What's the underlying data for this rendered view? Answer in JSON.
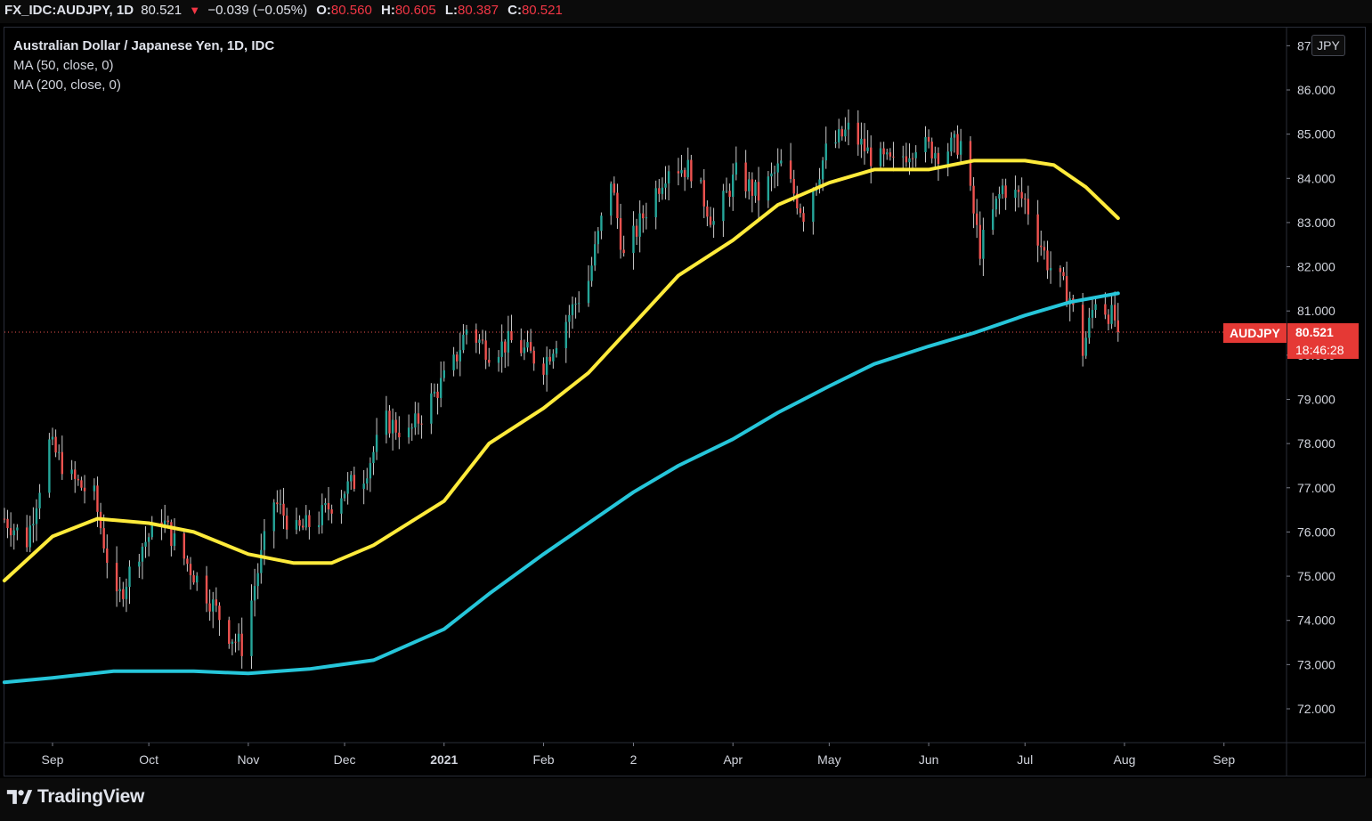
{
  "header": {
    "symbol": "FX_IDC:AUDJPY, 1D",
    "last": "80.521",
    "change": "−0.039 (−0.05%)",
    "open_label": "O:",
    "open": "80.560",
    "high_label": "H:",
    "high": "80.605",
    "low_label": "L:",
    "low": "80.387",
    "close_label": "C:",
    "close": "80.521"
  },
  "legend": {
    "title": "Australian Dollar / Japanese Yen, 1D, IDC",
    "ma50": "MA (50, close, 0)",
    "ma200": "MA (200, close, 0)"
  },
  "currency_badge": "JPY",
  "price_tag": {
    "symbol": "AUDJPY",
    "price": "80.521",
    "countdown": "18:46:28"
  },
  "footer": {
    "brand": "TradingView"
  },
  "colors": {
    "up": "#26a69a",
    "down": "#ef5350",
    "ma50": "#ffeb3b",
    "ma200": "#26c6da",
    "accent_red": "#e53935"
  },
  "chart_data": {
    "type": "candlestick",
    "title": "Australian Dollar / Japanese Yen, 1D, IDC",
    "ylim": [
      71.2,
      87.3
    ],
    "y_ticks": [
      72,
      73,
      74,
      75,
      76,
      77,
      78,
      79,
      80,
      81,
      82,
      83,
      84,
      85,
      86,
      87
    ],
    "y_tick_labels": [
      "72.000",
      "73.000",
      "74.000",
      "75.000",
      "76.000",
      "77.000",
      "78.000",
      "79.000",
      "80.000",
      "81.000",
      "82.000",
      "83.000",
      "84.000",
      "85.000",
      "86.000",
      "87"
    ],
    "x_labels": [
      "Sep",
      "Oct",
      "Nov",
      "Dec",
      "2021",
      "Feb",
      "2",
      "Apr",
      "May",
      "Jun",
      "Jul",
      "Aug",
      "Sep"
    ],
    "last_price": 80.521,
    "price_anchors": [
      [
        "2020-08-17",
        76.3
      ],
      [
        "2020-08-24",
        75.8
      ],
      [
        "2020-08-31",
        78.0
      ],
      [
        "2020-09-07",
        77.2
      ],
      [
        "2020-09-14",
        76.8
      ],
      [
        "2020-09-21",
        74.4
      ],
      [
        "2020-09-28",
        75.6
      ],
      [
        "2020-10-05",
        76.3
      ],
      [
        "2020-10-12",
        75.4
      ],
      [
        "2020-10-19",
        74.6
      ],
      [
        "2020-10-26",
        73.7
      ],
      [
        "2020-10-30",
        73.4
      ],
      [
        "2020-11-03",
        74.8
      ],
      [
        "2020-11-09",
        76.7
      ],
      [
        "2020-11-16",
        76.0
      ],
      [
        "2020-11-23",
        76.3
      ],
      [
        "2020-11-30",
        76.9
      ],
      [
        "2020-12-07",
        77.3
      ],
      [
        "2020-12-14",
        78.5
      ],
      [
        "2020-12-21",
        78.2
      ],
      [
        "2020-12-28",
        79.0
      ],
      [
        "2021-01-04",
        79.8
      ],
      [
        "2021-01-08",
        80.6
      ],
      [
        "2021-01-15",
        80.1
      ],
      [
        "2021-01-22",
        80.3
      ],
      [
        "2021-02-01",
        79.8
      ],
      [
        "2021-02-08",
        80.8
      ],
      [
        "2021-02-15",
        81.7
      ],
      [
        "2021-02-22",
        84.0
      ],
      [
        "2021-02-26",
        82.2
      ],
      [
        "2021-03-05",
        83.3
      ],
      [
        "2021-03-12",
        84.3
      ],
      [
        "2021-03-19",
        84.2
      ],
      [
        "2021-03-26",
        83.0
      ],
      [
        "2021-04-02",
        84.1
      ],
      [
        "2021-04-09",
        83.6
      ],
      [
        "2021-04-16",
        84.3
      ],
      [
        "2021-04-23",
        83.2
      ],
      [
        "2021-04-30",
        84.6
      ],
      [
        "2021-05-07",
        85.1
      ],
      [
        "2021-05-14",
        84.5
      ],
      [
        "2021-05-21",
        84.3
      ],
      [
        "2021-05-28",
        84.8
      ],
      [
        "2021-06-04",
        84.6
      ],
      [
        "2021-06-11",
        84.8
      ],
      [
        "2021-06-17",
        82.4
      ],
      [
        "2021-06-24",
        83.8
      ],
      [
        "2021-07-01",
        83.5
      ],
      [
        "2021-07-08",
        82.1
      ],
      [
        "2021-07-15",
        81.3
      ],
      [
        "2021-07-19",
        80.1
      ],
      [
        "2021-07-23",
        81.3
      ],
      [
        "2021-07-29",
        80.8
      ],
      [
        "2021-07-30",
        80.521
      ]
    ],
    "series": [
      {
        "name": "MA (50, close, 0)",
        "points": [
          [
            "2020-08-17",
            74.9
          ],
          [
            "2020-09-01",
            75.9
          ],
          [
            "2020-09-15",
            76.3
          ],
          [
            "2020-10-01",
            76.2
          ],
          [
            "2020-10-15",
            76.0
          ],
          [
            "2020-11-01",
            75.5
          ],
          [
            "2020-11-15",
            75.3
          ],
          [
            "2020-11-27",
            75.3
          ],
          [
            "2020-12-10",
            75.7
          ],
          [
            "2021-01-01",
            76.7
          ],
          [
            "2021-01-15",
            78.0
          ],
          [
            "2021-02-01",
            78.8
          ],
          [
            "2021-02-15",
            79.6
          ],
          [
            "2021-03-01",
            80.7
          ],
          [
            "2021-03-15",
            81.8
          ],
          [
            "2021-04-01",
            82.6
          ],
          [
            "2021-04-15",
            83.4
          ],
          [
            "2021-05-01",
            83.9
          ],
          [
            "2021-05-15",
            84.2
          ],
          [
            "2021-06-01",
            84.2
          ],
          [
            "2021-06-15",
            84.4
          ],
          [
            "2021-07-01",
            84.4
          ],
          [
            "2021-07-10",
            84.3
          ],
          [
            "2021-07-20",
            83.8
          ],
          [
            "2021-07-30",
            83.1
          ]
        ]
      },
      {
        "name": "MA (200, close, 0)",
        "points": [
          [
            "2020-08-17",
            72.6
          ],
          [
            "2020-09-01",
            72.7
          ],
          [
            "2020-09-20",
            72.85
          ],
          [
            "2020-10-15",
            72.85
          ],
          [
            "2020-11-01",
            72.8
          ],
          [
            "2020-11-20",
            72.9
          ],
          [
            "2020-12-10",
            73.1
          ],
          [
            "2021-01-01",
            73.8
          ],
          [
            "2021-01-15",
            74.6
          ],
          [
            "2021-02-01",
            75.5
          ],
          [
            "2021-02-15",
            76.2
          ],
          [
            "2021-03-01",
            76.9
          ],
          [
            "2021-03-15",
            77.5
          ],
          [
            "2021-04-01",
            78.1
          ],
          [
            "2021-04-15",
            78.7
          ],
          [
            "2021-05-01",
            79.3
          ],
          [
            "2021-05-15",
            79.8
          ],
          [
            "2021-06-01",
            80.2
          ],
          [
            "2021-06-15",
            80.5
          ],
          [
            "2021-07-01",
            80.9
          ],
          [
            "2021-07-15",
            81.2
          ],
          [
            "2021-07-30",
            81.4
          ]
        ]
      }
    ]
  }
}
